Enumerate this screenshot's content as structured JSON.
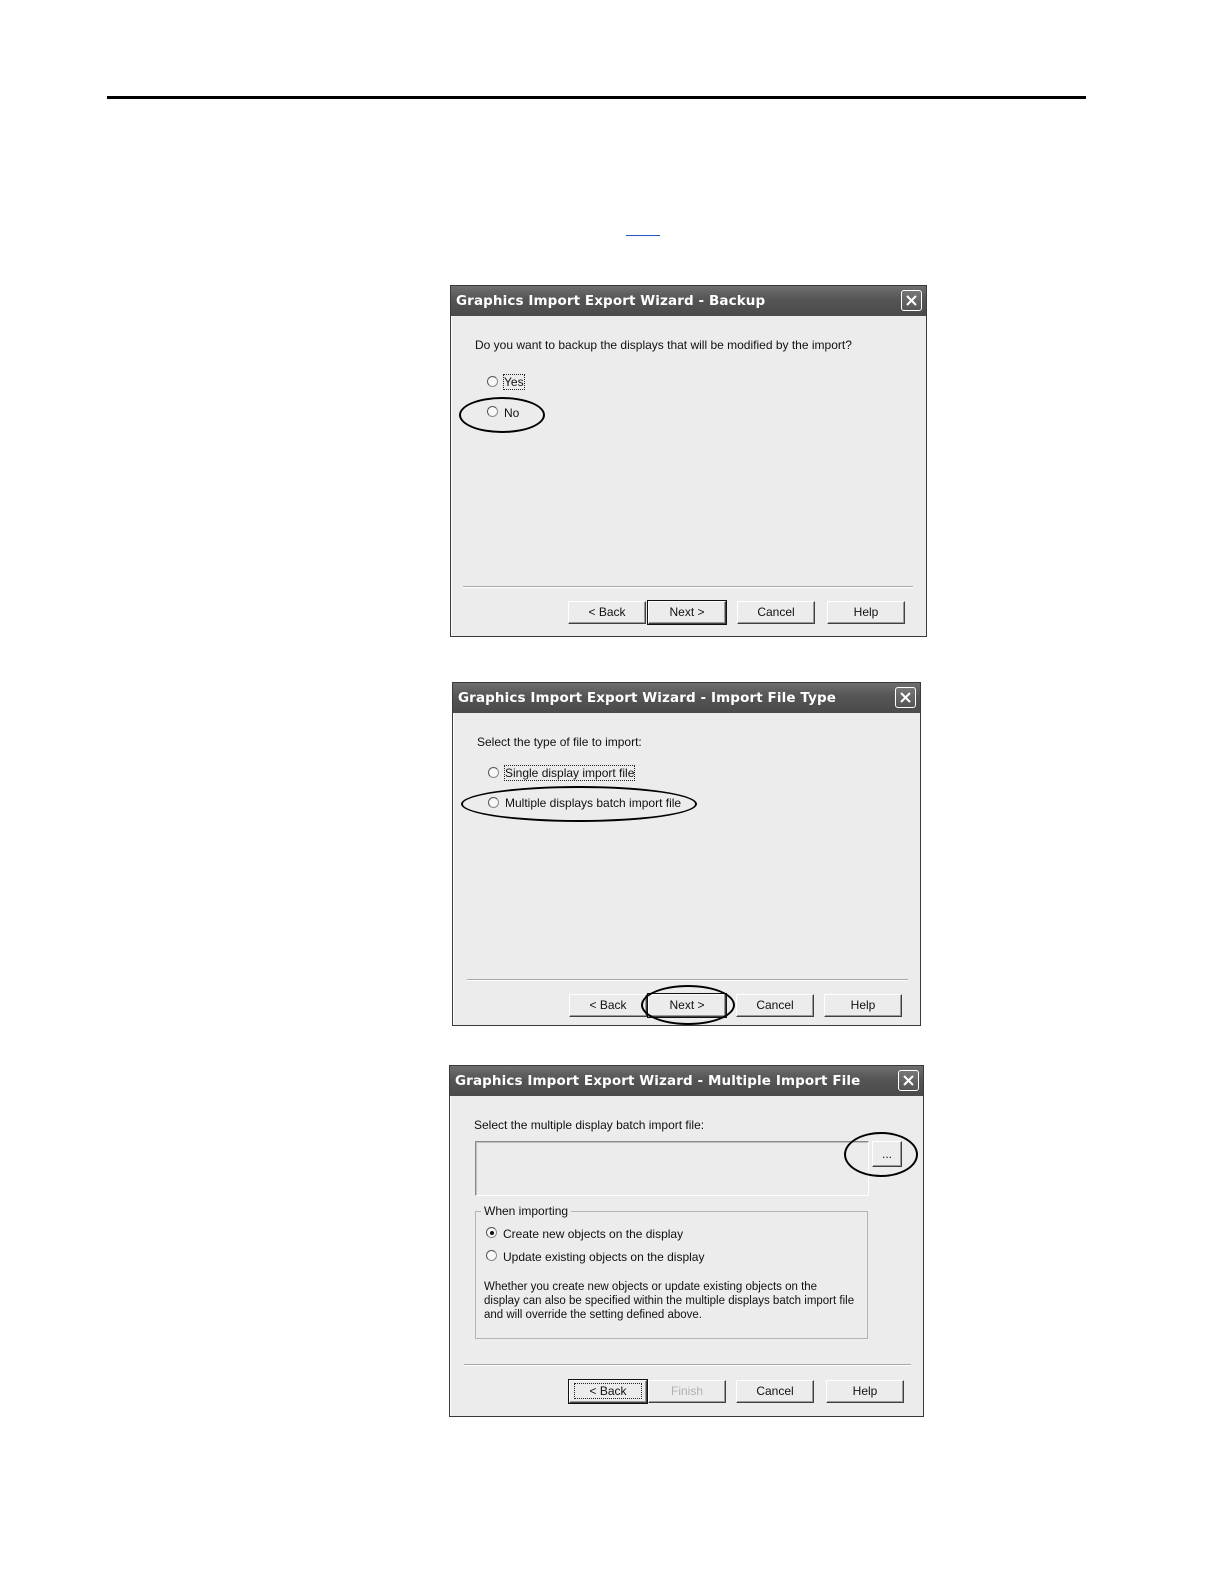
{
  "dialogs": {
    "backup": {
      "title": "Graphics Import Export Wizard - Backup",
      "prompt": "Do you want to backup the displays that will be modified by the import?",
      "options": [
        "Yes",
        "No"
      ],
      "buttons": {
        "back": "< Back",
        "next": "Next >",
        "cancel": "Cancel",
        "help": "Help"
      }
    },
    "file_type": {
      "title": "Graphics Import Export Wizard - Import File Type",
      "prompt": "Select the type of file to import:",
      "options": [
        "Single display import file",
        "Multiple displays batch import file"
      ],
      "buttons": {
        "back": "< Back",
        "next": "Next >",
        "cancel": "Cancel",
        "help": "Help"
      }
    },
    "multiple_import": {
      "title": "Graphics Import Export Wizard - Multiple Import File",
      "prompt": "Select the multiple display batch import file:",
      "file_path": "",
      "browse_label": "...",
      "group_label": "When importing",
      "options": [
        "Create new objects on the display",
        "Update existing objects on the display"
      ],
      "note": "Whether you create new objects or update existing objects on the display can also be specified within the multiple displays batch import file and will override the setting defined above.",
      "buttons": {
        "back": "< Back",
        "finish": "Finish",
        "cancel": "Cancel",
        "help": "Help"
      }
    }
  }
}
